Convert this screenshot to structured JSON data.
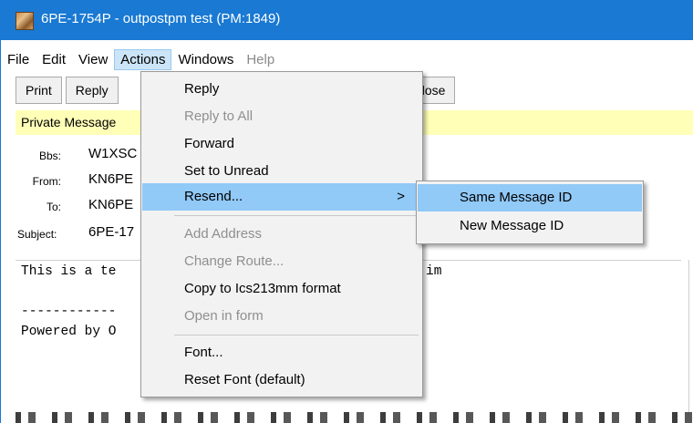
{
  "window": {
    "title": "6PE-1754P - outpostpm test  (PM:1849)",
    "accent_color": "#1979d3"
  },
  "menubar": {
    "items": [
      "File",
      "Edit",
      "View",
      "Actions",
      "Windows",
      "Help"
    ]
  },
  "toolbar": {
    "print_label": "Print",
    "reply_label": "Reply",
    "partial_label": "e",
    "close_label": "Close"
  },
  "banner": {
    "text": "Private Message",
    "color": "#ffffb8"
  },
  "header": {
    "bbs_label": "Bbs:",
    "bbs_value": "W1XSC",
    "from_label": "From:",
    "from_value": "KN6PE",
    "to_label": "To:",
    "to_value": "KN6PE",
    "subject_label": "Subject:",
    "subject_value": "6PE-17"
  },
  "body": {
    "line1": "This is a te",
    "line1_tail": "im",
    "line2": "------------",
    "line3": "Powered by O"
  },
  "actions_menu": {
    "items": [
      {
        "label": "Reply",
        "enabled": true
      },
      {
        "label": "Reply to All",
        "enabled": false
      },
      {
        "label": "Forward",
        "enabled": true
      },
      {
        "label": "Set to Unread",
        "enabled": true
      },
      {
        "label": "Resend...",
        "enabled": true,
        "submenu_arrow": ">"
      },
      {
        "label": "Add Address",
        "enabled": false
      },
      {
        "label": "Change Route...",
        "enabled": false
      },
      {
        "label": "Copy to Ics213mm format",
        "enabled": true
      },
      {
        "label": "Open in form",
        "enabled": false
      },
      {
        "label": "Font...",
        "enabled": true
      },
      {
        "label": "Reset Font (default)",
        "enabled": true
      }
    ]
  },
  "resend_submenu": {
    "items": [
      {
        "label": "Same Message ID"
      },
      {
        "label": "New Message ID"
      }
    ]
  }
}
